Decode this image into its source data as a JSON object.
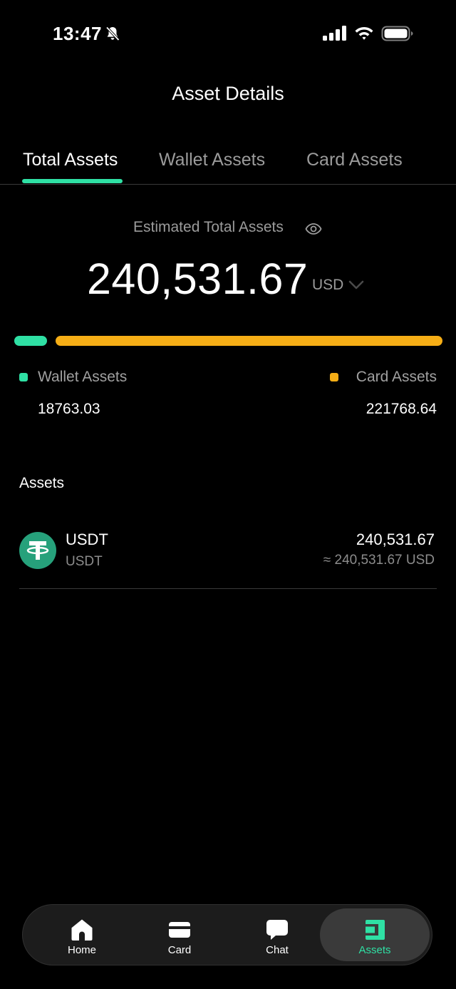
{
  "status_bar": {
    "time": "13:47"
  },
  "header": {
    "title": "Asset Details"
  },
  "tabs": [
    {
      "label": "Total Assets",
      "active": true
    },
    {
      "label": "Wallet Assets",
      "active": false
    },
    {
      "label": "Card Assets",
      "active": false
    }
  ],
  "summary": {
    "label": "Estimated Total Assets",
    "total": "240,531.67",
    "currency": "USD"
  },
  "breakdown": {
    "wallet": {
      "label": "Wallet Assets",
      "value": "18763.03",
      "color": "#2fe0a4"
    },
    "card": {
      "label": "Card Assets",
      "value": "221768.64",
      "color": "#f6ae16"
    }
  },
  "assets": {
    "title": "Assets",
    "items": [
      {
        "name": "USDT",
        "sub": "USDT",
        "amount": "240,531.67",
        "usd_value": "≈ 240,531.67 USD",
        "icon": "tether-icon"
      }
    ]
  },
  "bottom_nav": [
    {
      "label": "Home",
      "icon": "home-icon"
    },
    {
      "label": "Card",
      "icon": "card-icon"
    },
    {
      "label": "Chat",
      "icon": "chat-icon"
    },
    {
      "label": "Assets",
      "icon": "wallet-icon",
      "active": true
    }
  ],
  "colors": {
    "accent": "#2fe0a4",
    "card": "#f6ae16",
    "background": "#000000"
  }
}
